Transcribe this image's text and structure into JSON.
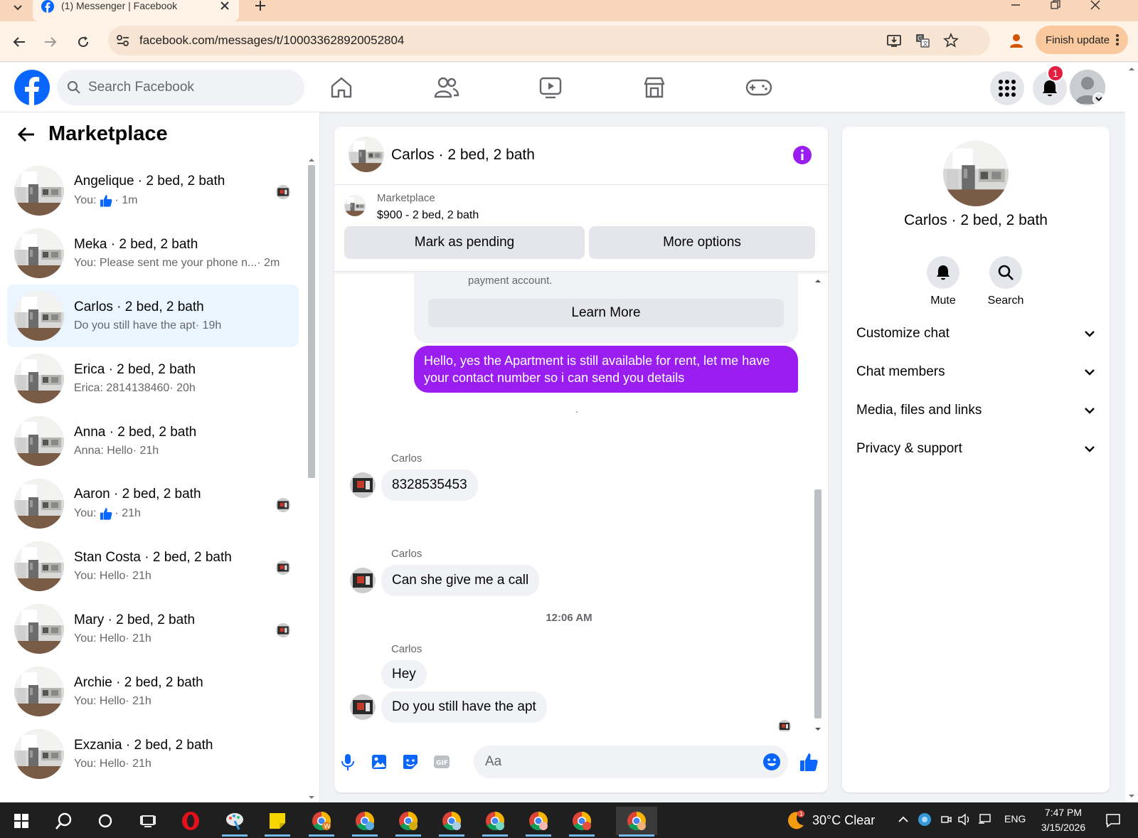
{
  "browser": {
    "tab_title": "(1) Messenger | Facebook",
    "url": "facebook.com/messages/t/100033628920052804",
    "finish_update": "Finish update"
  },
  "fb": {
    "search_placeholder": "Search Facebook",
    "notification_count": "1"
  },
  "left": {
    "title": "Marketplace",
    "conversations": [
      {
        "name": "Angelique · 2 bed, 2 bath",
        "preview_prefix": "You:",
        "preview": "",
        "time": "· 1m",
        "like": true,
        "seen": true
      },
      {
        "name": "Meka · 2 bed, 2 bath",
        "preview_prefix": "",
        "preview": "You: Please sent me your phone n...",
        "time": " · 2m",
        "like": false,
        "seen": false
      },
      {
        "name": "Carlos · 2 bed, 2 bath",
        "preview_prefix": "",
        "preview": "Do you still have the apt",
        "time": " · 19h",
        "like": false,
        "seen": false,
        "selected": true
      },
      {
        "name": "Erica · 2 bed, 2 bath",
        "preview_prefix": "",
        "preview": "Erica: 2814138460",
        "time": " · 20h",
        "like": false,
        "seen": false
      },
      {
        "name": "Anna · 2 bed, 2 bath",
        "preview_prefix": "",
        "preview": "Anna: Hello",
        "time": " · 21h",
        "like": false,
        "seen": false
      },
      {
        "name": "Aaron · 2 bed, 2 bath",
        "preview_prefix": "You:",
        "preview": "",
        "time": "· 21h",
        "like": true,
        "seen": true
      },
      {
        "name": "Stan Costa · 2 bed, 2 bath",
        "preview_prefix": "",
        "preview": "You: Hello",
        "time": " · 21h",
        "like": false,
        "seen": true
      },
      {
        "name": "Mary · 2 bed, 2 bath",
        "preview_prefix": "",
        "preview": "You: Hello",
        "time": " · 21h",
        "like": false,
        "seen": true
      },
      {
        "name": "Archie · 2 bed, 2 bath",
        "preview_prefix": "",
        "preview": "You: Hello",
        "time": " · 21h",
        "like": false,
        "seen": false
      },
      {
        "name": "Exzania · 2 bed, 2 bath",
        "preview_prefix": "",
        "preview": "You: Hello",
        "time": " · 21h",
        "like": false,
        "seen": false
      }
    ]
  },
  "chat": {
    "title": "Carlos · 2 bed, 2 bath",
    "marketplace_label": "Marketplace",
    "listing": "$900 - 2 bed, 2 bath",
    "mark_pending": "Mark as pending",
    "more_options": "More options",
    "card_text": "payment account.",
    "learn_more": "Learn More",
    "outgoing": "Hello, yes the Apartment is still available for rent, let me have your contact number so i can send you details",
    "sender": "Carlos",
    "msg1": "8328535453",
    "msg2": "Can she give me a call",
    "timestamp": "12:06 AM",
    "msg3": "Hey",
    "msg4": "Do you still have the apt",
    "composer_placeholder": "Aa"
  },
  "right": {
    "name": "Carlos · 2 bed, 2 bath",
    "mute": "Mute",
    "search": "Search",
    "sections": [
      "Customize chat",
      "Chat members",
      "Media, files and links",
      "Privacy & support"
    ]
  },
  "taskbar": {
    "weather": "30°C  Clear",
    "lang": "ENG",
    "time": "7:47 PM",
    "date": "3/15/2026"
  },
  "colors": {
    "fb_blue": "#0866ff",
    "messenger_purple": "#9a1ef0",
    "badge_red": "#e41e3f",
    "tab_bar": "#f9d6b9"
  }
}
